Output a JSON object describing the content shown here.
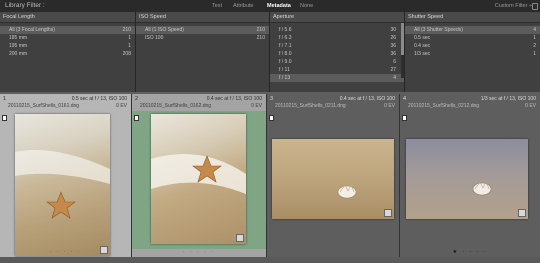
{
  "topbar": {
    "title": "Library Filter :",
    "filters": [
      "Text",
      "Attribute",
      "Metadata",
      "None"
    ],
    "active_filter": "Metadata",
    "custom_filter": "Custom Filter ÷"
  },
  "columns": [
    {
      "header": "Focal Length",
      "rows": [
        {
          "label": "All (3 Focal Lengths)",
          "count": "210",
          "selected": true
        },
        {
          "label": "185 mm",
          "count": "1",
          "selected": false
        },
        {
          "label": "195 mm",
          "count": "1",
          "selected": false
        },
        {
          "label": "200 mm",
          "count": "208",
          "selected": false
        }
      ]
    },
    {
      "header": "ISO Speed",
      "rows": [
        {
          "label": "All (1 ISO Speed)",
          "count": "210",
          "selected": true
        },
        {
          "label": "ISO 100",
          "count": "210",
          "selected": false
        }
      ]
    },
    {
      "header": "Aperture",
      "rows": [
        {
          "label": "f / 5.6",
          "count": "30",
          "selected": false
        },
        {
          "label": "f / 6.3",
          "count": "26",
          "selected": false
        },
        {
          "label": "f / 7.1",
          "count": "36",
          "selected": false
        },
        {
          "label": "f / 8.0",
          "count": "36",
          "selected": false
        },
        {
          "label": "f / 9.0",
          "count": "6",
          "selected": false
        },
        {
          "label": "f / 11",
          "count": "27",
          "selected": false
        },
        {
          "label": "f / 13",
          "count": "4",
          "selected": true
        }
      ]
    },
    {
      "header": "Shutter Speed",
      "rows": [
        {
          "label": "All (3 Shutter Speeds)",
          "count": "4",
          "selected": true
        },
        {
          "label": "0.5 sec",
          "count": "1",
          "selected": false
        },
        {
          "label": "0.4 sec",
          "count": "2",
          "selected": false
        },
        {
          "label": "1/3 sec",
          "count": "1",
          "selected": false
        }
      ]
    }
  ],
  "cells": [
    {
      "num": "1",
      "info": "0.5 sec at f / 13, ISO 100",
      "fname": "20110215_SurfShells_0161.dng",
      "ev": "0 EV",
      "stars": "· · · · ·"
    },
    {
      "num": "2",
      "info": "0.4 sec at f / 13, ISO 100",
      "fname": "20110215_SurfShells_0162.dng",
      "ev": "0 EV",
      "stars": "· · · · ·"
    },
    {
      "num": "3",
      "info": "0.4 sec at f / 13, ISO 100",
      "fname": "20110215_SurfShells_0211.dng",
      "ev": "0 EV",
      "stars": "· · · · ·"
    },
    {
      "num": "4",
      "info": "1/3 sec at f / 13, ISO 100",
      "fname": "20110215_SurfShells_0212.dng",
      "ev": "0 EV",
      "stars": "★ · · · ·"
    }
  ]
}
